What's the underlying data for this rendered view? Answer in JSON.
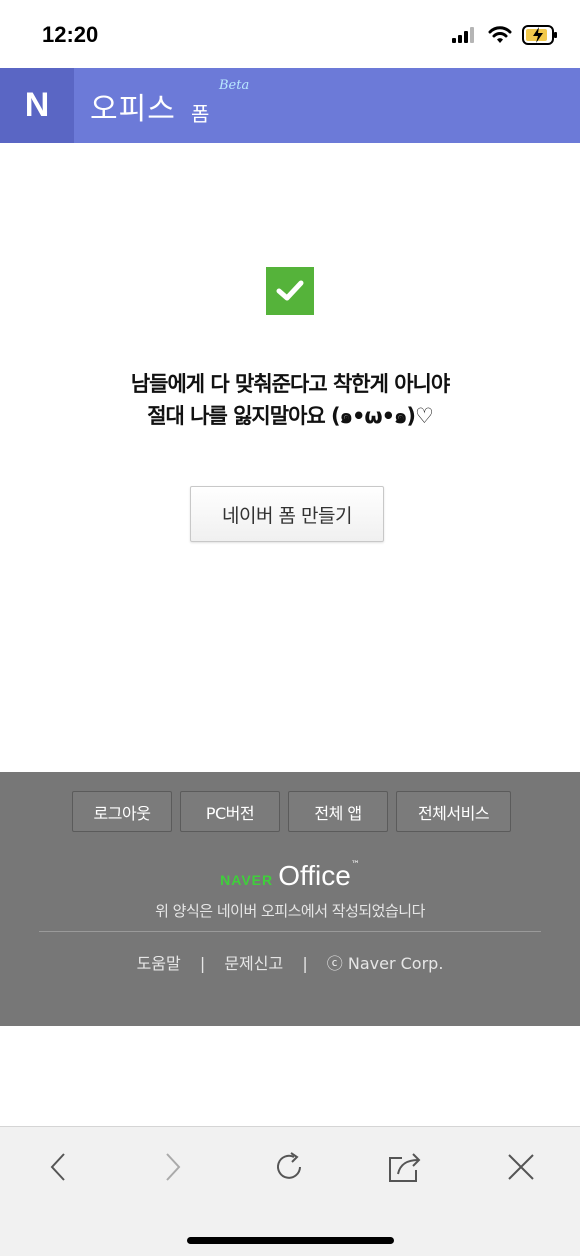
{
  "status_bar": {
    "time": "12:20",
    "icons": [
      "signal-icon",
      "wifi-icon",
      "battery-charging-icon"
    ]
  },
  "header": {
    "logo": "N",
    "title": "오피스",
    "subtitle": "폼",
    "badge": "Beta",
    "accent_color": "#6c7ad8"
  },
  "main": {
    "check_icon": "check-icon",
    "message_line1": "남들에게 다 맞춰준다고 착한게 아니야",
    "message_line2": "절대 나를 잃지말아요 (๑•ω•๑)♡",
    "create_button_label": "네이버 폼 만들기"
  },
  "footer": {
    "buttons": [
      "로그아웃",
      "PC버전",
      "전체 앱",
      "전체서비스"
    ],
    "brand_naver": "NAVER",
    "brand_office": "Office",
    "brand_tm": "™",
    "note": "위 양식은 네이버 오피스에서 작성되었습니다",
    "links": {
      "help": "도움말",
      "report": "문제신고",
      "copyright": "ⓒ Naver Corp.",
      "separator": "|"
    }
  },
  "browser_toolbar": {
    "icons": [
      "back-icon",
      "forward-icon",
      "reload-icon",
      "share-icon",
      "close-icon"
    ]
  }
}
